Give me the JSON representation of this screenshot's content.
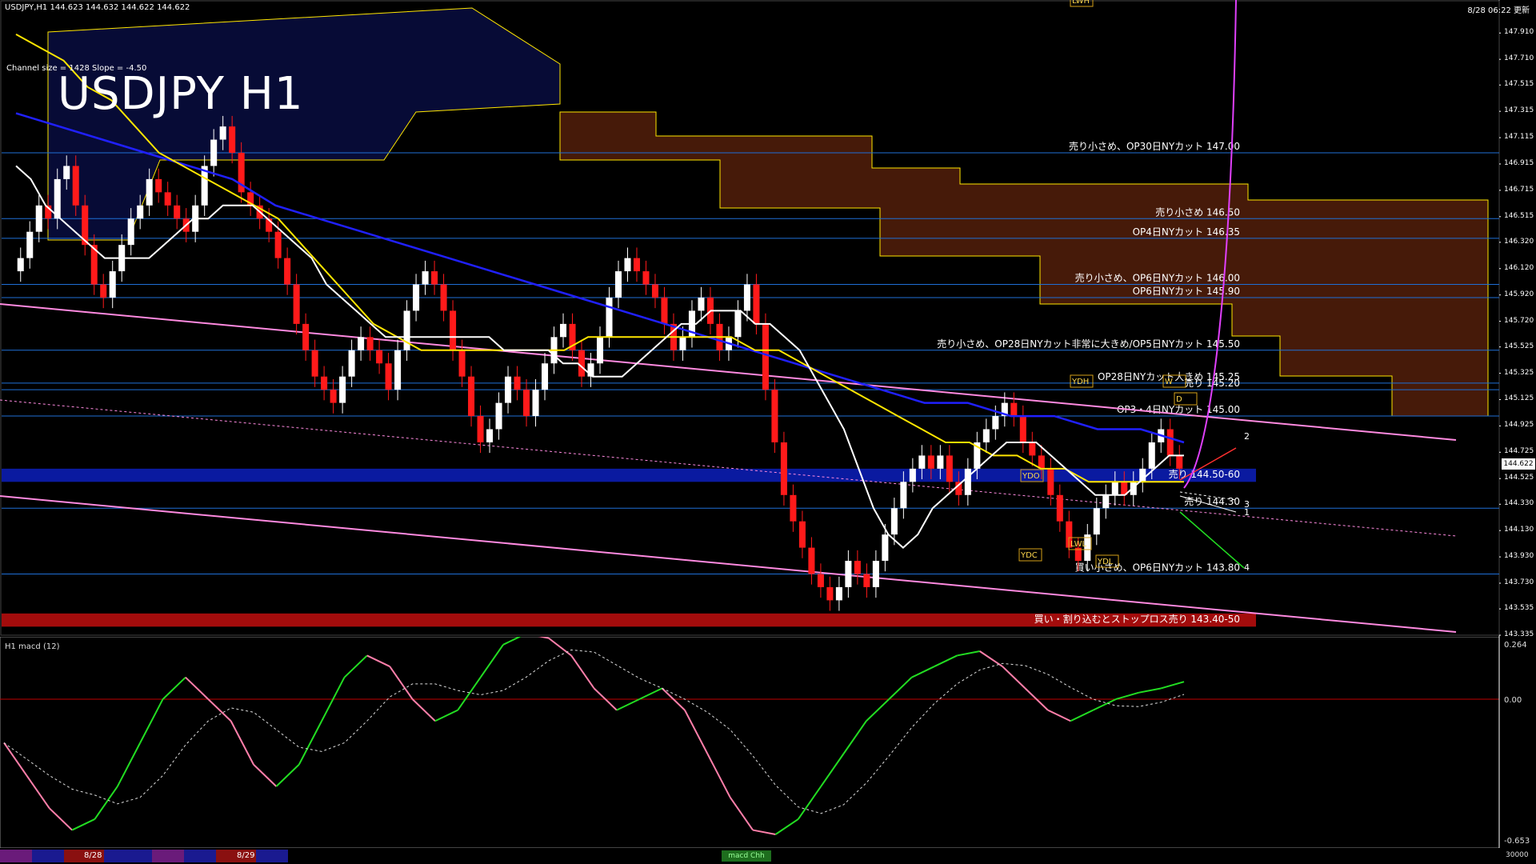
{
  "header": {
    "symbol_line": "USDJPY,H1  144.623 144.632 144.622 144.622",
    "timestamp": "8/28 06:22 更新",
    "channel_info": "Channel size = 1428 Slope = -4.50",
    "title": "USDJPY H1",
    "current_price": "144.622"
  },
  "colors": {
    "background": "#000000",
    "axis": "#ffffff",
    "level_line": "#1f6fd6",
    "bull_candle": "#ffffff",
    "bear_candle": "#ff1a1a",
    "kumo": "#c84a1a",
    "sma_yellow": "#ffe600",
    "ma_blue": "#2020ff",
    "ma_white": "#ffffff",
    "channel": "#ff8ae0",
    "macd_up": "#22dd22",
    "macd_down": "#ff7faa",
    "sell_band": "#0a1aa0",
    "buy_band": "#a30c0c"
  },
  "chart_data": {
    "type": "candlestick",
    "timeframe": "H1",
    "symbol": "USDJPY",
    "ylim": [
      143.335,
      148.1
    ],
    "y_ticks": [
      "147.910",
      "147.710",
      "147.515",
      "147.315",
      "147.115",
      "146.915",
      "146.715",
      "146.515",
      "146.320",
      "146.120",
      "145.920",
      "145.720",
      "145.525",
      "145.325",
      "145.125",
      "144.925",
      "144.725",
      "144.525",
      "144.330",
      "144.130",
      "143.930",
      "143.730",
      "143.535",
      "143.335"
    ],
    "closes": [
      146.2,
      146.4,
      146.6,
      146.5,
      146.8,
      146.9,
      146.6,
      146.3,
      146.0,
      145.9,
      146.1,
      146.3,
      146.5,
      146.6,
      146.8,
      146.7,
      146.6,
      146.5,
      146.4,
      146.6,
      146.9,
      147.1,
      147.2,
      147.0,
      146.7,
      146.6,
      146.5,
      146.4,
      146.2,
      146.0,
      145.7,
      145.5,
      145.3,
      145.2,
      145.1,
      145.3,
      145.5,
      145.6,
      145.5,
      145.4,
      145.2,
      145.5,
      145.8,
      146.0,
      146.1,
      146.0,
      145.8,
      145.5,
      145.3,
      145.0,
      144.8,
      144.9,
      145.1,
      145.3,
      145.2,
      145.0,
      145.2,
      145.4,
      145.6,
      145.7,
      145.5,
      145.3,
      145.4,
      145.6,
      145.9,
      146.1,
      146.2,
      146.1,
      146.0,
      145.9,
      145.7,
      145.5,
      145.6,
      145.8,
      145.9,
      145.7,
      145.5,
      145.6,
      145.8,
      146.0,
      145.7,
      145.2,
      144.8,
      144.4,
      144.2,
      144.0,
      143.8,
      143.7,
      143.6,
      143.7,
      143.9,
      143.8,
      143.7,
      143.9,
      144.1,
      144.3,
      144.5,
      144.6,
      144.7,
      144.6,
      144.7,
      144.5,
      144.4,
      144.6,
      144.8,
      144.9,
      145.0,
      145.1,
      145.0,
      144.8,
      144.7,
      144.6,
      144.4,
      144.2,
      144.0,
      143.9,
      144.1,
      144.3,
      144.4,
      144.5,
      144.4,
      144.5,
      144.6,
      144.8,
      144.9,
      144.7,
      144.6
    ],
    "ma_white": [
      146.9,
      146.8,
      146.6,
      146.5,
      146.4,
      146.3,
      146.2,
      146.2,
      146.2,
      146.2,
      146.3,
      146.4,
      146.5,
      146.5,
      146.6,
      146.6,
      146.6,
      146.5,
      146.4,
      146.3,
      146.2,
      146.0,
      145.9,
      145.8,
      145.7,
      145.6,
      145.6,
      145.6,
      145.6,
      145.6,
      145.6,
      145.6,
      145.6,
      145.5,
      145.5,
      145.5,
      145.5,
      145.4,
      145.4,
      145.3,
      145.3,
      145.3,
      145.4,
      145.5,
      145.6,
      145.7,
      145.7,
      145.8,
      145.8,
      145.8,
      145.7,
      145.7,
      145.6,
      145.5,
      145.3,
      145.1,
      144.9,
      144.6,
      144.3,
      144.1,
      144.0,
      144.1,
      144.3,
      144.4,
      144.5,
      144.6,
      144.7,
      144.8,
      144.8,
      144.8,
      144.7,
      144.6,
      144.5,
      144.4,
      144.4,
      144.4,
      144.5,
      144.6,
      144.7,
      144.7
    ],
    "sma_yellow": [
      147.9,
      147.8,
      147.7,
      147.5,
      147.4,
      147.2,
      147.0,
      146.9,
      146.8,
      146.7,
      146.6,
      146.5,
      146.3,
      146.1,
      145.9,
      145.7,
      145.6,
      145.5,
      145.5,
      145.5,
      145.5,
      145.5,
      145.5,
      145.5,
      145.6,
      145.6,
      145.6,
      145.6,
      145.6,
      145.6,
      145.6,
      145.5,
      145.5,
      145.4,
      145.3,
      145.2,
      145.1,
      145.0,
      144.9,
      144.8,
      144.8,
      144.7,
      144.7,
      144.6,
      144.6,
      144.5,
      144.5,
      144.5,
      144.5,
      144.5
    ],
    "ma_blue": [
      147.3,
      147.2,
      147.1,
      147.0,
      146.9,
      146.8,
      146.6,
      146.5,
      146.4,
      146.3,
      146.2,
      146.1,
      146.0,
      145.9,
      145.8,
      145.7,
      145.6,
      145.5,
      145.4,
      145.3,
      145.2,
      145.1,
      145.1,
      145.0,
      145.0,
      144.9,
      144.9,
      144.8
    ],
    "levels": [
      {
        "price": 147.0,
        "label": "売り小さめ、OP30日NYカット 147.00"
      },
      {
        "price": 146.5,
        "label": "売り小さめ 146.50"
      },
      {
        "price": 146.35,
        "label": "OP4日NYカット 146.35"
      },
      {
        "price": 146.0,
        "label": "売り小さめ、OP6日NYカット 146.00"
      },
      {
        "price": 145.9,
        "label": "OP6日NYカット 145.90"
      },
      {
        "price": 145.5,
        "label": "売り小さめ、OP28日NYカット非常に大きめ/OP5日NYカット 145.50"
      },
      {
        "price": 145.25,
        "label": "OP28日NYカット大きめ 145.25"
      },
      {
        "price": 145.2,
        "label": "売り 145.20"
      },
      {
        "price": 145.0,
        "label": "OP3・4日NYカット 145.00"
      },
      {
        "price": 144.3,
        "label": "売り 144.30"
      },
      {
        "price": 143.8,
        "label": "買い小さめ、OP6日NYカット 143.80"
      }
    ],
    "bands": [
      {
        "from": 144.5,
        "to": 144.6,
        "label": "売り 144.50-60",
        "kind": "sell"
      },
      {
        "from": 143.4,
        "to": 143.5,
        "label": "買い・割り込むとストップロス売り 143.40-50",
        "kind": "buy"
      }
    ],
    "markers": [
      "YDH",
      "YDO",
      "YDC",
      "YDL",
      "LWL",
      "LWH",
      "W",
      "D"
    ],
    "projection_labels": [
      "1",
      "2",
      "3",
      "4"
    ]
  },
  "macd": {
    "label": "H1  macd (12)",
    "top": "0.264",
    "zero": "0.00",
    "bottom": "-0.653",
    "values": [
      -0.2,
      -0.35,
      -0.5,
      -0.6,
      -0.55,
      -0.4,
      -0.2,
      0.0,
      0.1,
      0.0,
      -0.1,
      -0.3,
      -0.4,
      -0.3,
      -0.1,
      0.1,
      0.2,
      0.15,
      0.0,
      -0.1,
      -0.05,
      0.1,
      0.25,
      0.3,
      0.28,
      0.2,
      0.05,
      -0.05,
      0.0,
      0.05,
      -0.05,
      -0.25,
      -0.45,
      -0.6,
      -0.62,
      -0.55,
      -0.4,
      -0.25,
      -0.1,
      0.0,
      0.1,
      0.15,
      0.2,
      0.22,
      0.15,
      0.05,
      -0.05,
      -0.1,
      -0.05,
      0.0,
      0.03,
      0.05,
      0.08
    ]
  },
  "bottom_strip": {
    "date1": "8/28",
    "date2": "8/29",
    "tab": "macd Chh",
    "value": "30000"
  }
}
